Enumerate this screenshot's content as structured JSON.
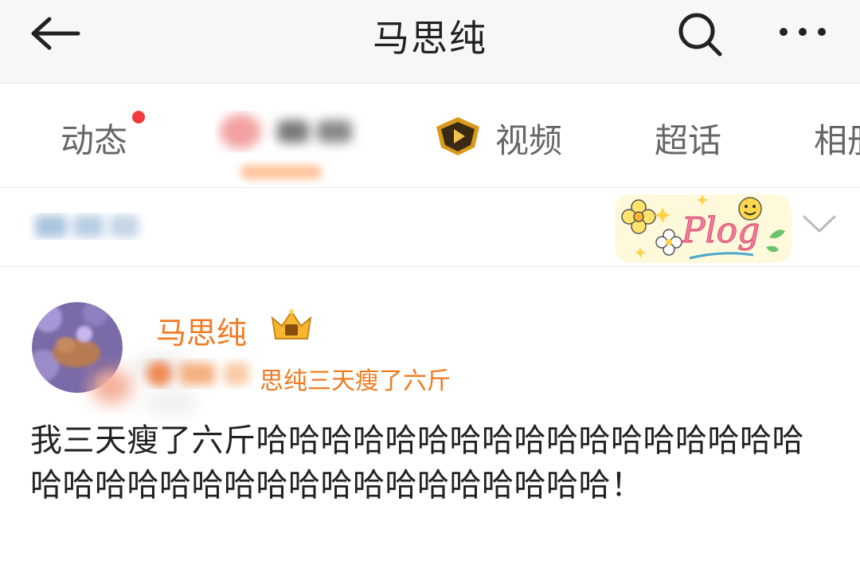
{
  "header": {
    "title": "马思纯",
    "back_icon": "arrow-left-icon",
    "search_icon": "search-icon",
    "more_icon": "more-horizontal-icon"
  },
  "tabs": [
    {
      "label": "动态",
      "has_dot": true,
      "active": false
    },
    {
      "label": "",
      "blurred": true
    },
    {
      "label": "视频",
      "icon": "video-badge-icon"
    },
    {
      "label": "超话"
    },
    {
      "label": "相册"
    }
  ],
  "filter": {
    "chevron_icon": "chevron-down-icon",
    "sticker": "plog-sticker"
  },
  "post": {
    "author": "马思纯",
    "source_text": "思纯三天瘦了六斤",
    "body": "我三天瘦了六斤哈哈哈哈哈哈哈哈哈哈哈哈哈哈哈哈哈哈哈哈哈哈哈哈哈哈哈哈哈哈哈哈哈哈哈！"
  },
  "colors": {
    "accent_orange": "#f27a24",
    "notify_red": "#f23b3b",
    "header_bg": "#f7f7f7"
  }
}
